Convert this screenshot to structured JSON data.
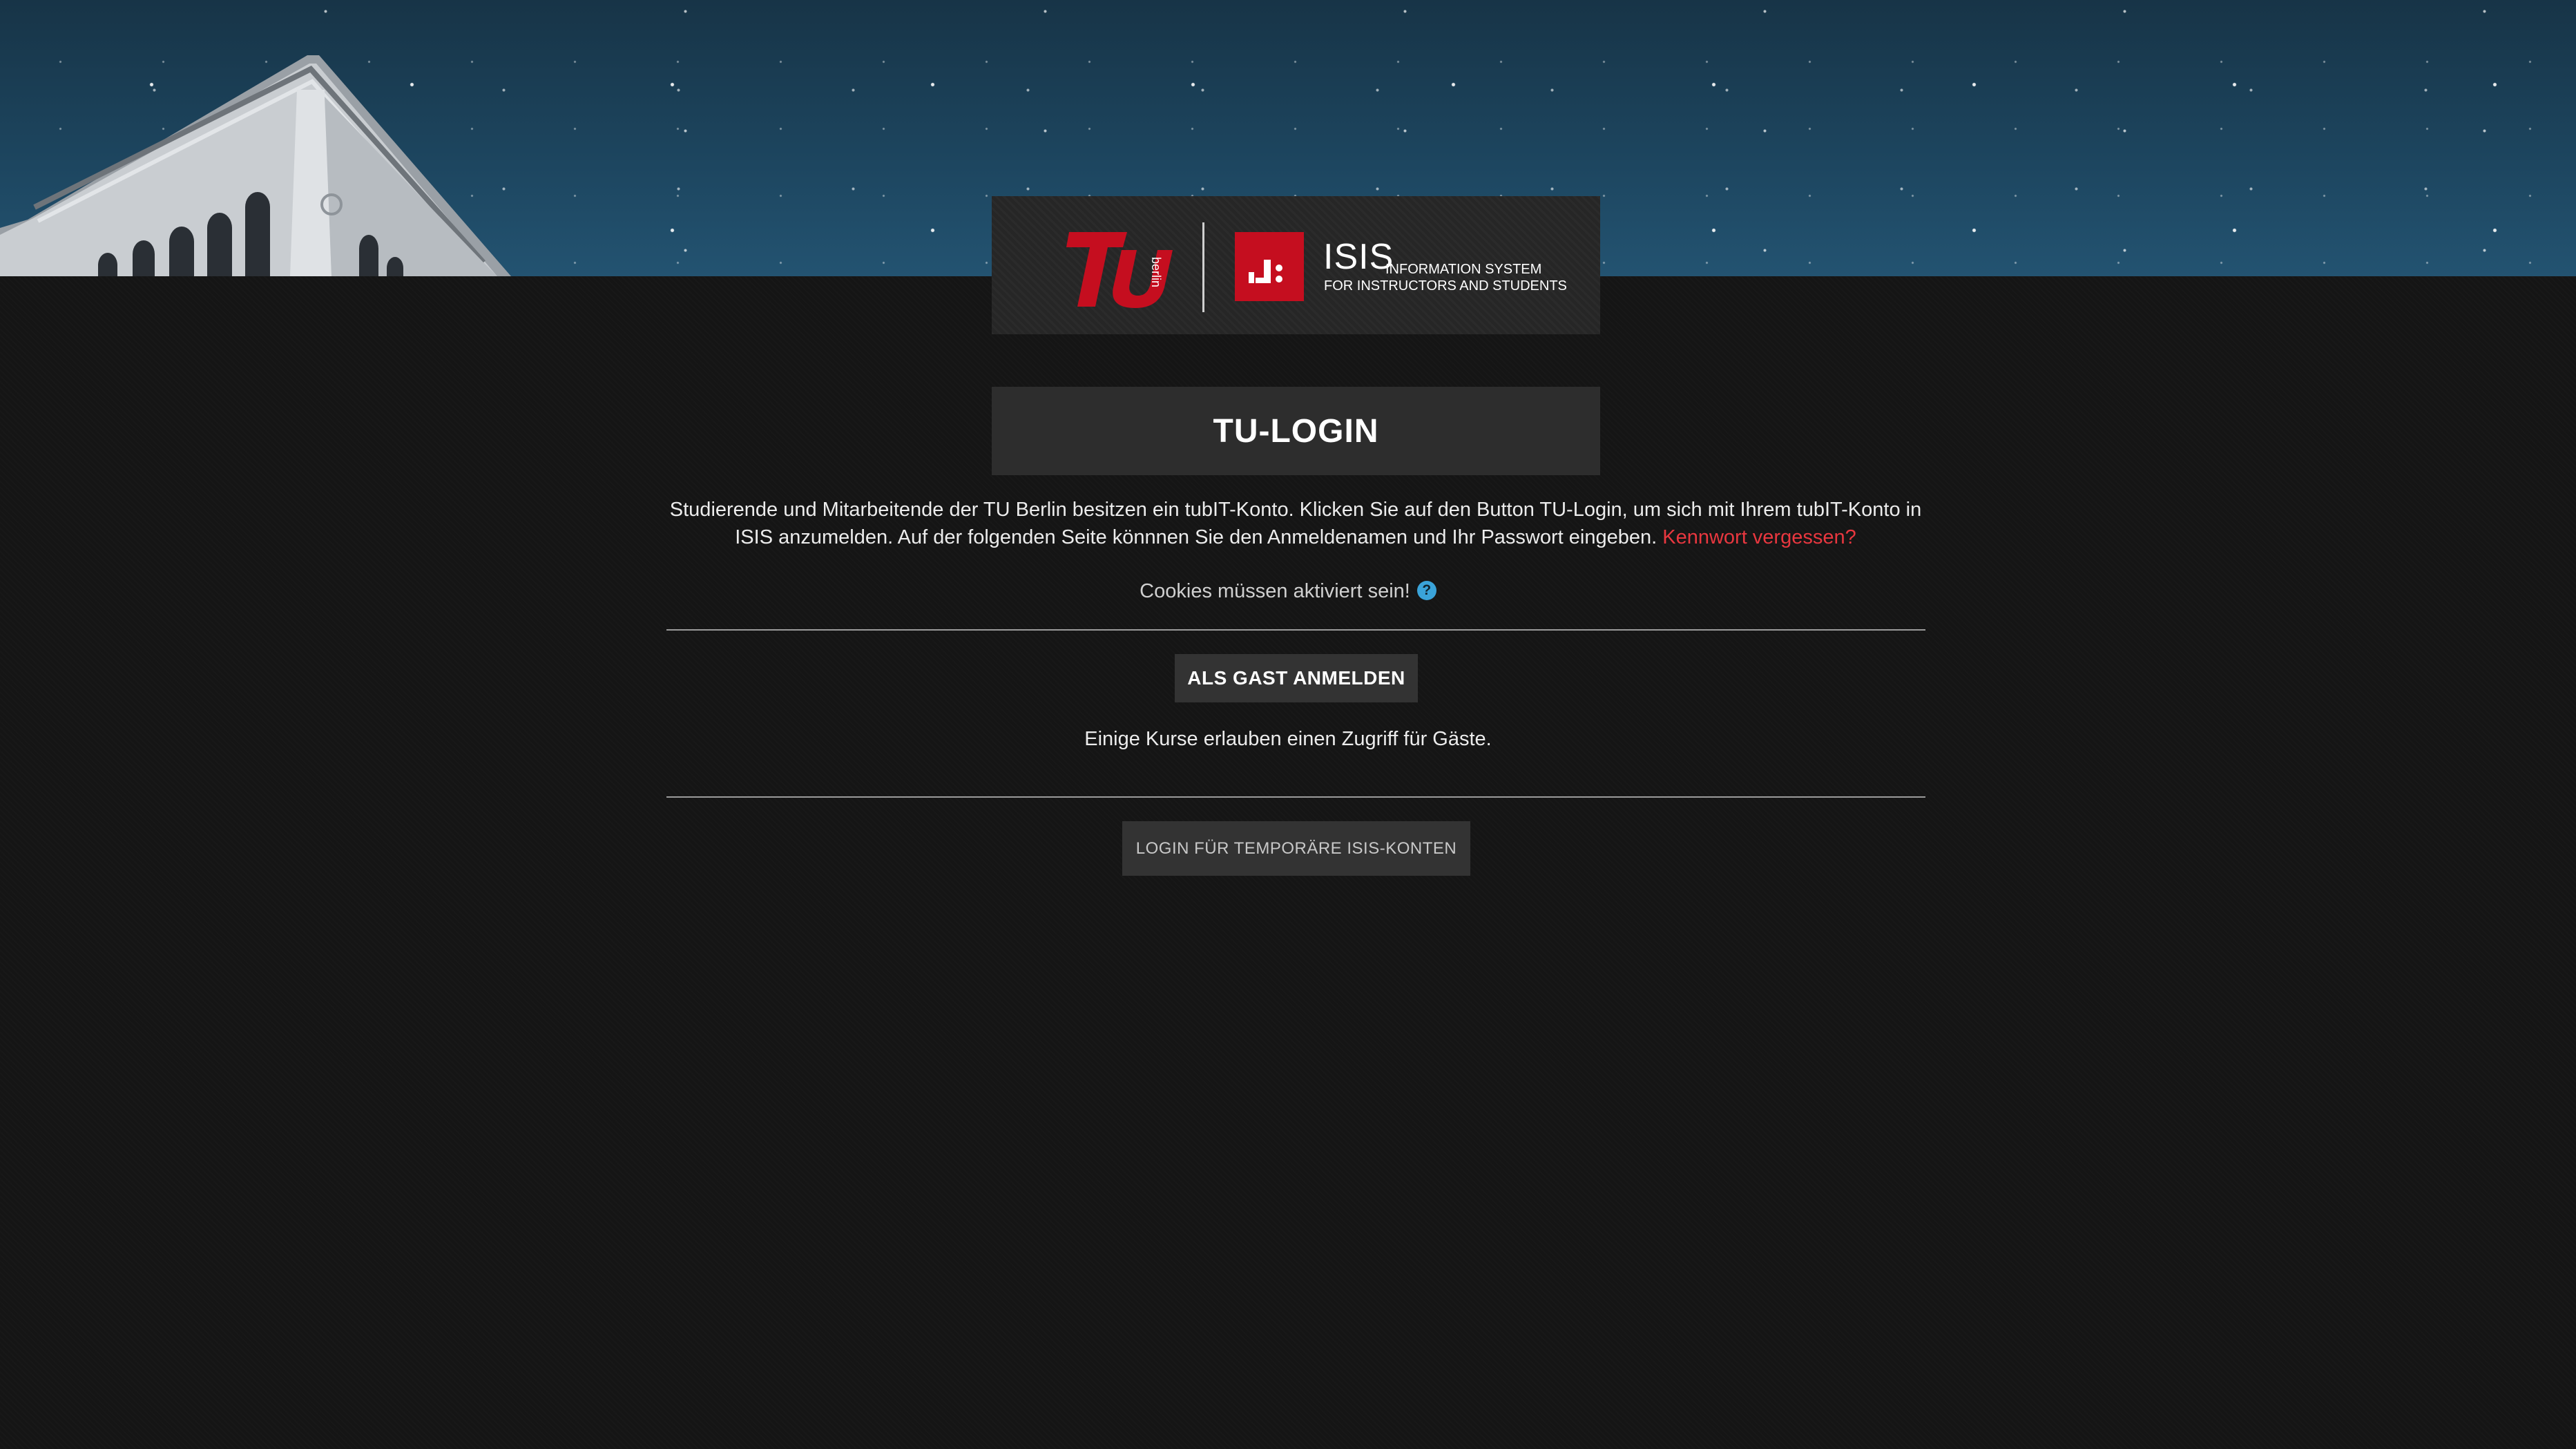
{
  "header": {
    "tu_logo_text": "TU",
    "tu_logo_sub": "berlin",
    "isis_name": "ISIS",
    "isis_tagline_1": "INFORMATION SYSTEM",
    "isis_tagline_2": "FOR INSTRUCTORS AND STUDENTS"
  },
  "login": {
    "title": "TU-LOGIN",
    "intro_text": "Studierende und Mitarbeitende der TU Berlin besitzen ein tubIT-Konto. Klicken Sie auf den Button TU-Login, um sich mit Ihrem tubIT-Konto in ISIS anzumelden. Auf der folgenden Seite könnnen Sie den Anmeldenamen und Ihr Passwort eingeben.",
    "forgot_link": "Kennwort vergessen?",
    "cookies_notice": "Cookies müssen aktiviert sein!",
    "help_glyph": "?"
  },
  "guest": {
    "button_label": "ALS GAST ANMELDEN",
    "note": "Einige Kurse erlauben einen Zugriff für Gäste."
  },
  "temp": {
    "button_label": "LOGIN FÜR TEMPORÄRE ISIS-KONTEN"
  },
  "colors": {
    "background": "#151515",
    "panel": "#2d2d2d",
    "link": "#e8373f",
    "brand_red": "#c50e1f",
    "help": "#3aa3d9"
  },
  "icons": {
    "tu_berlin_logo": "tu-berlin-logo",
    "isis_logo": "isis-logo-icon",
    "help": "help-icon"
  }
}
